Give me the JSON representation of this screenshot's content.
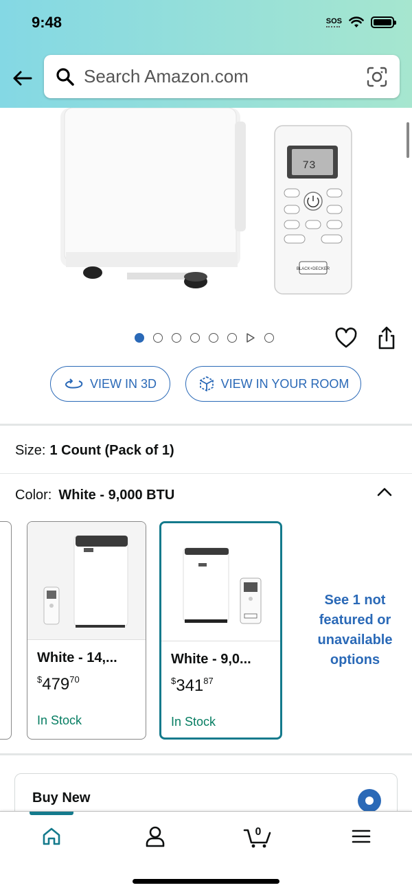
{
  "status_bar": {
    "time": "9:48",
    "sos": "SOS"
  },
  "header": {
    "search_placeholder": "Search Amazon.com"
  },
  "image_carousel": {
    "remote_display": "73",
    "brand_label": "BLACK+DECKER",
    "total_dots": 8,
    "active_index": 0
  },
  "actions": {
    "view_3d": "VIEW IN 3D",
    "view_room": "VIEW IN YOUR ROOM"
  },
  "size": {
    "label": "Size:",
    "value": "1 Count (Pack of 1)"
  },
  "color": {
    "label": "Color:",
    "value": "White - 9,000 BTU"
  },
  "swatches": [
    {
      "name": "White - 14,...",
      "price_symbol": "$",
      "price_whole": "479",
      "price_fraction": "70",
      "stock": "In Stock",
      "selected": false
    },
    {
      "name": "White - 9,0...",
      "price_symbol": "$",
      "price_whole": "341",
      "price_fraction": "87",
      "stock": "In Stock",
      "selected": true
    }
  ],
  "see_more": "See 1 not featured or unavailable options",
  "buy_box": {
    "title": "Buy New"
  },
  "bottom_nav": {
    "cart_count": "0"
  },
  "colors": {
    "accent_blue": "#2a69b7",
    "teal": "#147a8c",
    "in_stock_green": "#067d62"
  }
}
